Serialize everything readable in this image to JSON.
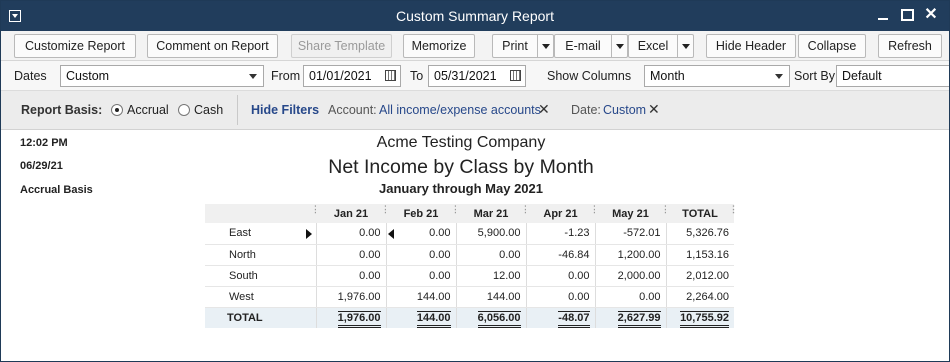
{
  "window": {
    "title": "Custom Summary Report"
  },
  "toolbar": {
    "customize": "Customize Report",
    "comment": "Comment on Report",
    "share": "Share Template",
    "memorize": "Memorize",
    "print": "Print",
    "email": "E-mail",
    "excel": "Excel",
    "hide_header": "Hide Header",
    "collapse": "Collapse",
    "refresh": "Refresh"
  },
  "filters": {
    "dates_label": "Dates",
    "dates_value": "Custom",
    "from_label": "From",
    "from_value": "01/01/2021",
    "to_label": "To",
    "to_value": "05/31/2021",
    "show_columns_label": "Show Columns",
    "show_columns_value": "Month",
    "sort_by_label": "Sort By",
    "sort_by_value": "Default"
  },
  "basis": {
    "label": "Report Basis:",
    "accrual": "Accrual",
    "cash": "Cash",
    "selected": "Accrual",
    "hide_filters": "Hide Filters",
    "account_filter_label": "Account:",
    "account_filter_value": "All income/expense accounts",
    "date_filter_label": "Date:",
    "date_filter_value": "Custom"
  },
  "report": {
    "time": "12:02 PM",
    "date": "06/29/21",
    "basis": "Accrual Basis",
    "company": "Acme Testing Company",
    "title": "Net Income by Class by Month",
    "period": "January through May 2021",
    "columns": [
      "Jan 21",
      "Feb 21",
      "Mar 21",
      "Apr 21",
      "May 21",
      "TOTAL"
    ],
    "rows": [
      {
        "label": "East",
        "values": [
          "0.00",
          "0.00",
          "5,900.00",
          "-1.23",
          "-572.01",
          "5,326.76"
        ]
      },
      {
        "label": "North",
        "values": [
          "0.00",
          "0.00",
          "0.00",
          "-46.84",
          "1,200.00",
          "1,153.16"
        ]
      },
      {
        "label": "South",
        "values": [
          "0.00",
          "0.00",
          "12.00",
          "0.00",
          "2,000.00",
          "2,012.00"
        ]
      },
      {
        "label": "West",
        "values": [
          "1,976.00",
          "144.00",
          "144.00",
          "0.00",
          "0.00",
          "2,264.00"
        ]
      }
    ],
    "total": {
      "label": "TOTAL",
      "values": [
        "1,976.00",
        "144.00",
        "6,056.00",
        "-48.07",
        "2,627.99",
        "10,755.92"
      ]
    }
  }
}
